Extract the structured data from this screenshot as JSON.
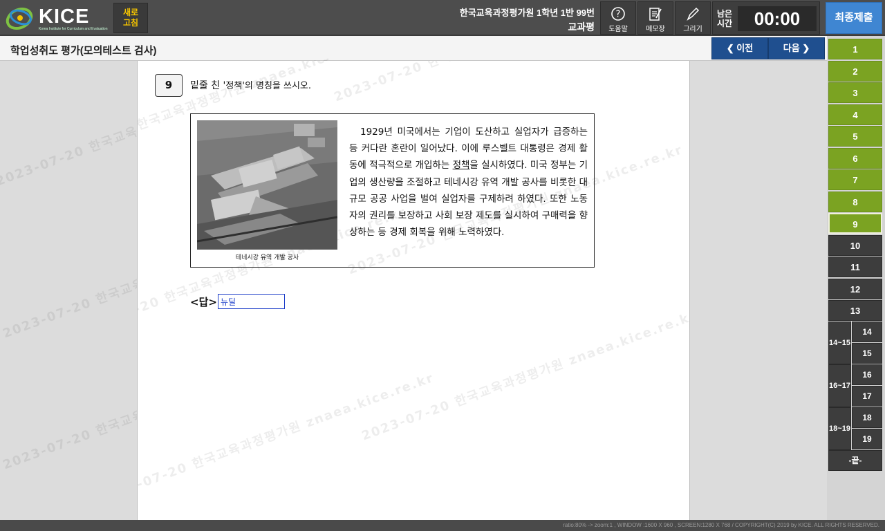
{
  "header": {
    "logo_text": "KICE",
    "logo_sub": "Korea Institute for Curriculum and Evaluation",
    "refresh_line1": "새로",
    "refresh_line2": "고침",
    "exam_info_line1": "한국교육과정평가원 1학년 1반 99번",
    "exam_info_line2": "교과평",
    "tools": {
      "help": "도움말",
      "memo": "메모장",
      "draw": "그리기"
    },
    "remaining_label_1": "남은",
    "remaining_label_2": "시간",
    "remaining_time": "00:00",
    "submit_label": "최종제출"
  },
  "titlebar": {
    "title": "학업성취도 평가(모의테스트 검사)",
    "prev_label": "❮ 이전",
    "next_label": "다음 ❯"
  },
  "question": {
    "number": "9",
    "text_before": "밑줄 친 '",
    "text_emph": "정책",
    "text_after": "'의 명칭을 쓰시오.",
    "caption": "테네시강 유역 개발 공사",
    "passage_before": "1929년 미국에서는 기업이 도산하고 실업자가 급증하는 등 커다란 혼란이 일어났다. 이에 루스벨트 대통령은 경제 활동에 적극적으로 개입하는 ",
    "passage_underline": "정책",
    "passage_after": "을 실시하였다. 미국 정부는 기업의 생산량을 조절하고 테네시강 유역 개발 공사를 비롯한 대규모 공공 사업을 벌여 실업자를 구제하려 하였다. 또한 노동자의 권리를 보장하고 사회 보장 제도를 실시하여 구매력을 향상하는 등 경제 회복을 위해 노력하였다.",
    "answer_label": "<답>",
    "answer_value": "뉴딜"
  },
  "qnav": {
    "items": [
      "1",
      "2",
      "3",
      "4",
      "5",
      "6",
      "7",
      "8",
      "9",
      "10",
      "11",
      "12",
      "13"
    ],
    "groups": [
      {
        "label": "14~15",
        "items": [
          "14",
          "15"
        ]
      },
      {
        "label": "16~17",
        "items": [
          "16",
          "17"
        ]
      },
      {
        "label": "18~19",
        "items": [
          "18",
          "19"
        ]
      }
    ],
    "end_label": "-끝-"
  },
  "watermark": "2023-07-20 한국교육과정평가원 znaea.kice.re.kr",
  "footer": "ratio:80% -> zoom:1 , WINDOW :1600 X 960 , SCREEN:1280 X 768 / COPYRIGHT(C) 2019 by KICE. ALL RIGHTS RESERVED.",
  "colors": {
    "answered": "#7ba322",
    "unanswered": "#3d3d3d",
    "submit": "#3f86d2",
    "nav": "#1f4f8f"
  }
}
